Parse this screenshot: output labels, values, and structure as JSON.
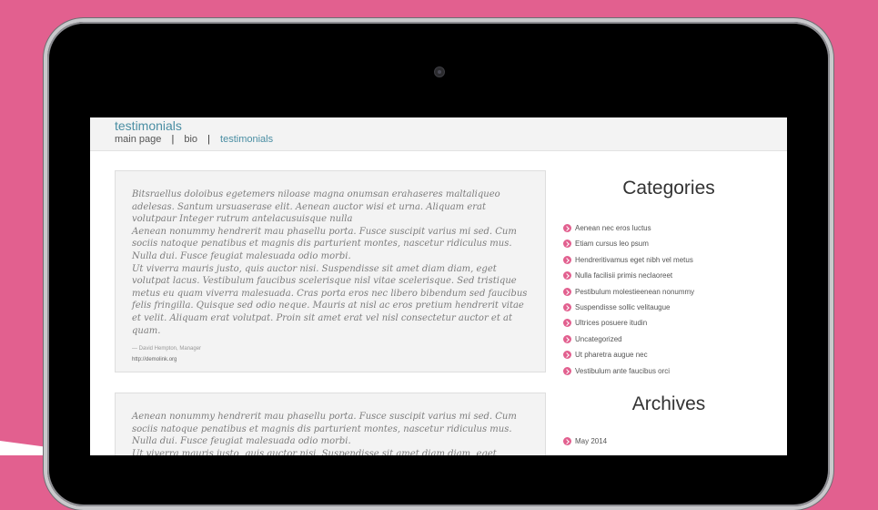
{
  "site": {
    "title": "testimonials",
    "nav": [
      "main page",
      "bio",
      "testimonials"
    ]
  },
  "testimonials": [
    {
      "text": "Bitsraellus doloibus egetemers niloase magna onumsan erahaseres maltaliqueo adelesas. Santum ursuaserase elit. Aenean auctor wisi et urna. Aliquam erat volutpaur Integer rutrum antelacusuisque nulla\nAenean nonummy hendrerit mau phasellu porta. Fusce suscipit varius mi sed. Cum sociis natoque penatibus et magnis dis parturient montes, nascetur ridiculus mus. Nulla dui. Fusce feugiat malesuada odio morbi.\nUt viverra mauris justo, quis auctor nisi. Suspendisse sit amet diam diam, eget volutpat lacus. Vestibulum faucibus scelerisque nisl vitae scelerisque. Sed tristique metus eu quam viverra malesuada. Cras porta eros nec libero bibendum sed faucibus felis fringilla. Quisque sed odio neque. Mauris at nisl ac eros pretium hendrerit vitae et velit. Aliquam erat volutpat. Proin sit amet erat vel nisl consectetur auctor et at quam.",
      "author": "— David Hempton, Manager",
      "link": "http://demolink.org"
    },
    {
      "text": "Aenean nonummy hendrerit mau phasellu porta. Fusce suscipit varius mi sed. Cum sociis natoque penatibus et magnis dis parturient montes, nascetur ridiculus mus. Nulla dui. Fusce feugiat malesuada odio morbi.\nUt viverra mauris justo, quis auctor nisi. Suspendisse sit amet diam diam, eget volutpat"
    }
  ],
  "sidebar": {
    "categories_title": "Categories",
    "categories": [
      "Aenean nec eros luctus",
      "Etiam cursus leo psum",
      "Hendreritivamus eget nibh vel metus",
      "Nulla facilisii primis neclaoreet",
      "Pestibulum molestieenean nonummy",
      "Suspendisse sollic velitaugue",
      "Ultrices posuere itudin",
      "Uncategorized",
      "Ut pharetra augue nec",
      "Vestibulum ante faucibus orci"
    ],
    "archives_title": "Archives",
    "archives": [
      "May 2014"
    ]
  },
  "colors": {
    "background": "#e2608f",
    "accent": "#4a8ea3",
    "bullet": "#e2608f"
  }
}
